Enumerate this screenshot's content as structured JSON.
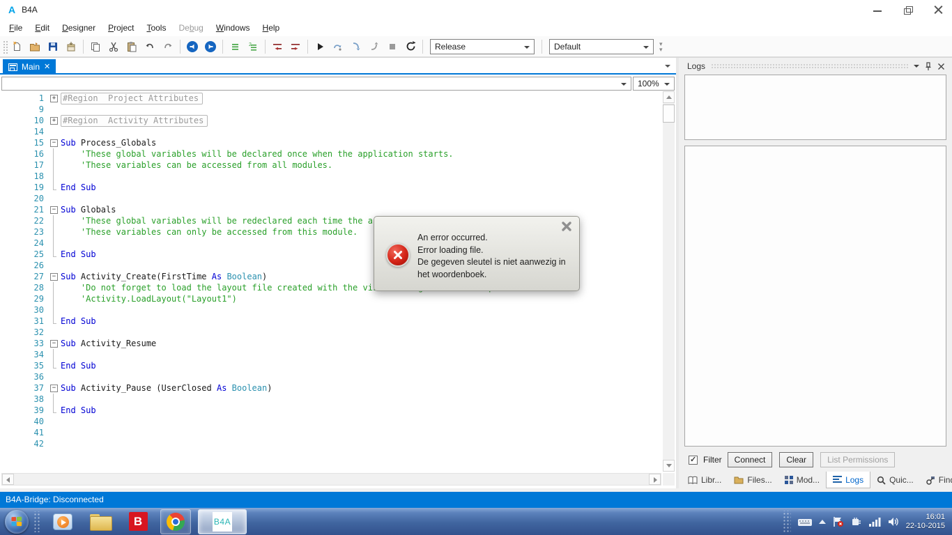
{
  "colors": {
    "accent": "#0078d7",
    "error_red": "#c41e1e",
    "keyword_blue": "#0000d4",
    "comment_green": "#2aa02a",
    "type_teal": "#2b91af"
  },
  "window": {
    "title": "B4A"
  },
  "menu": {
    "items": [
      {
        "label": "File",
        "accel": 0,
        "enabled": true
      },
      {
        "label": "Edit",
        "accel": 0,
        "enabled": true
      },
      {
        "label": "Designer",
        "accel": 0,
        "enabled": true
      },
      {
        "label": "Project",
        "accel": 0,
        "enabled": true
      },
      {
        "label": "Tools",
        "accel": 0,
        "enabled": true
      },
      {
        "label": "Debug",
        "accel": 2,
        "enabled": false
      },
      {
        "label": "Windows",
        "accel": 0,
        "enabled": true
      },
      {
        "label": "Help",
        "accel": 0,
        "enabled": true
      }
    ]
  },
  "toolbar": {
    "build_config": "Release",
    "run_config": "Default",
    "icons": [
      "new-file",
      "open-project",
      "save",
      "export",
      "copy",
      "cut",
      "paste",
      "undo",
      "redo",
      "navigate-back",
      "navigate-forward",
      "comment",
      "uncomment",
      "shift-left",
      "shift-right",
      "run",
      "step-over",
      "step-into",
      "step-out",
      "stop",
      "rebuild"
    ]
  },
  "editor": {
    "tab": {
      "label": "Main"
    },
    "module_selector": "",
    "zoom_level": "100%",
    "lines": [
      {
        "n": "1",
        "fold": "plus",
        "tokens": [
          {
            "c": "region",
            "t": "#Region  Project Attributes"
          }
        ]
      },
      {
        "n": "9",
        "fold": null,
        "tokens": []
      },
      {
        "n": "10",
        "fold": "plus",
        "tokens": [
          {
            "c": "region",
            "t": "#Region  Activity Attributes"
          }
        ]
      },
      {
        "n": "14",
        "fold": null,
        "tokens": []
      },
      {
        "n": "15",
        "fold": "minus",
        "tokens": [
          {
            "c": "kw",
            "t": "Sub"
          },
          {
            "c": "pl",
            "t": " Process_Globals"
          }
        ]
      },
      {
        "n": "16",
        "fold": "bar",
        "tokens": [
          {
            "c": "cm",
            "t": "    'These global variables will be declared once when the application starts."
          }
        ]
      },
      {
        "n": "17",
        "fold": "bar",
        "tokens": [
          {
            "c": "cm",
            "t": "    'These variables can be accessed from all modules."
          }
        ]
      },
      {
        "n": "18",
        "fold": "bar",
        "tokens": []
      },
      {
        "n": "19",
        "fold": "end",
        "tokens": [
          {
            "c": "kw",
            "t": "End Sub"
          }
        ]
      },
      {
        "n": "20",
        "fold": null,
        "tokens": []
      },
      {
        "n": "21",
        "fold": "minus",
        "tokens": [
          {
            "c": "kw",
            "t": "Sub"
          },
          {
            "c": "pl",
            "t": " Globals"
          }
        ]
      },
      {
        "n": "22",
        "fold": "bar",
        "tokens": [
          {
            "c": "cm",
            "t": "    'These global variables will be redeclared each time the activity is created."
          }
        ]
      },
      {
        "n": "23",
        "fold": "bar",
        "tokens": [
          {
            "c": "cm",
            "t": "    'These variables can only be accessed from this module."
          }
        ]
      },
      {
        "n": "24",
        "fold": "bar",
        "tokens": []
      },
      {
        "n": "25",
        "fold": "end",
        "tokens": [
          {
            "c": "kw",
            "t": "End Sub"
          }
        ]
      },
      {
        "n": "26",
        "fold": null,
        "tokens": []
      },
      {
        "n": "27",
        "fold": "minus",
        "tokens": [
          {
            "c": "kw",
            "t": "Sub"
          },
          {
            "c": "pl",
            "t": " Activity_Create(FirstTime "
          },
          {
            "c": "kw",
            "t": "As"
          },
          {
            "c": "ty",
            "t": " Boolean"
          },
          {
            "c": "pl",
            "t": ")"
          }
        ]
      },
      {
        "n": "28",
        "fold": "bar",
        "tokens": [
          {
            "c": "cm",
            "t": "    'Do not forget to load the layout file created with the visual designer. For example:"
          }
        ]
      },
      {
        "n": "29",
        "fold": "bar",
        "tokens": [
          {
            "c": "cm",
            "t": "    'Activity.LoadLayout(\"Layout1\")"
          }
        ]
      },
      {
        "n": "30",
        "fold": "bar",
        "tokens": []
      },
      {
        "n": "31",
        "fold": "end",
        "tokens": [
          {
            "c": "kw",
            "t": "End Sub"
          }
        ]
      },
      {
        "n": "32",
        "fold": null,
        "tokens": []
      },
      {
        "n": "33",
        "fold": "minus",
        "tokens": [
          {
            "c": "kw",
            "t": "Sub"
          },
          {
            "c": "pl",
            "t": " Activity_Resume"
          }
        ]
      },
      {
        "n": "34",
        "fold": "bar",
        "tokens": []
      },
      {
        "n": "35",
        "fold": "end",
        "tokens": [
          {
            "c": "kw",
            "t": "End Sub"
          }
        ]
      },
      {
        "n": "36",
        "fold": null,
        "tokens": []
      },
      {
        "n": "37",
        "fold": "minus",
        "tokens": [
          {
            "c": "kw",
            "t": "Sub"
          },
          {
            "c": "pl",
            "t": " Activity_Pause (UserClosed "
          },
          {
            "c": "kw",
            "t": "As"
          },
          {
            "c": "ty",
            "t": " Boolean"
          },
          {
            "c": "pl",
            "t": ")"
          }
        ]
      },
      {
        "n": "38",
        "fold": "bar",
        "tokens": []
      },
      {
        "n": "39",
        "fold": "end",
        "tokens": [
          {
            "c": "kw",
            "t": "End Sub"
          }
        ]
      },
      {
        "n": "40",
        "fold": null,
        "tokens": []
      },
      {
        "n": "41",
        "fold": null,
        "tokens": []
      },
      {
        "n": "42",
        "fold": null,
        "tokens": []
      }
    ]
  },
  "dialog": {
    "message_lines": [
      "An error occurred.",
      "Error loading file.",
      "De gegeven sleutel is niet aanwezig in",
      "het woordenboek."
    ]
  },
  "logs": {
    "title": "Logs",
    "filter_label": "Filter",
    "filter_checked": true,
    "buttons": [
      {
        "label": "Connect",
        "enabled": true
      },
      {
        "label": "Clear",
        "enabled": true
      },
      {
        "label": "List Permissions",
        "enabled": false
      }
    ],
    "tabs": [
      {
        "label": "Libr...",
        "icon": "book-icon",
        "active": false
      },
      {
        "label": "Files...",
        "icon": "folder-icon",
        "active": false
      },
      {
        "label": "Mod...",
        "icon": "modules-icon",
        "active": false
      },
      {
        "label": "Logs",
        "icon": "logs-icon",
        "active": true
      },
      {
        "label": "Quic...",
        "icon": "search-icon",
        "active": false
      },
      {
        "label": "Find...",
        "icon": "find-icon",
        "active": false
      }
    ]
  },
  "statusbar": {
    "text": "B4A-Bridge: Disconnected"
  },
  "taskbar": {
    "bitdefender_letter": "B",
    "b4a_button_label": "B4A",
    "clock": {
      "time": "16:01",
      "date": "22-10-2015"
    }
  }
}
